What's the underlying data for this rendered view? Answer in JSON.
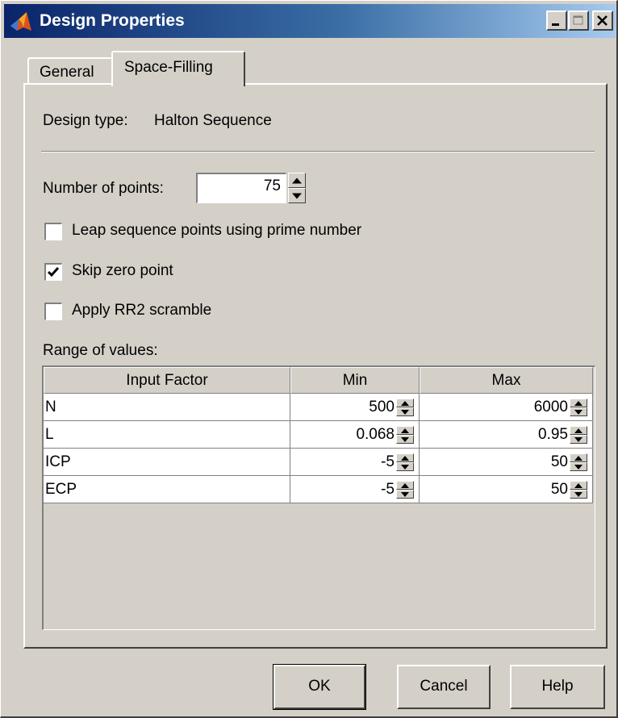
{
  "window": {
    "title": "Design Properties",
    "buttons": [
      "minimize",
      "maximize",
      "close"
    ]
  },
  "tabs": [
    {
      "label": "General",
      "active": false
    },
    {
      "label": "Space-Filling",
      "active": true
    }
  ],
  "design": {
    "type_label": "Design type:",
    "type_value": "Halton Sequence"
  },
  "points": {
    "label": "Number of points:",
    "value": "75"
  },
  "options": [
    {
      "label": "Leap sequence points using prime number",
      "checked": false
    },
    {
      "label": "Skip zero point",
      "checked": true
    },
    {
      "label": "Apply RR2 scramble",
      "checked": false
    }
  ],
  "range": {
    "label": "Range of values:",
    "columns": [
      "Input Factor",
      "Min",
      "Max"
    ],
    "rows": [
      {
        "factor": "N",
        "min": "500",
        "max": "6000"
      },
      {
        "factor": "L",
        "min": "0.068",
        "max": "0.95"
      },
      {
        "factor": "ICP",
        "min": "-5",
        "max": "50"
      },
      {
        "factor": "ECP",
        "min": "-5",
        "max": "50"
      }
    ]
  },
  "footer": {
    "ok": "OK",
    "cancel": "Cancel",
    "help": "Help"
  },
  "icons": {
    "app": "matlab-membrane-icon",
    "check": "checkmark-icon",
    "spin": "spin-arrows-icon"
  },
  "colors": {
    "titlebar_start": "#0a246a",
    "titlebar_end": "#a6caf0",
    "face": "#d4d0c8"
  }
}
